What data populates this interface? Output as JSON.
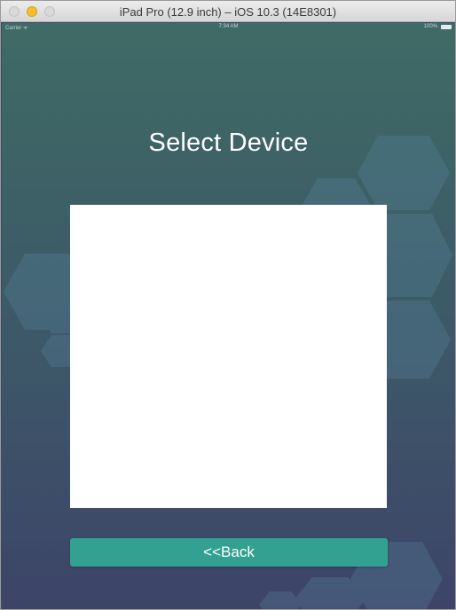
{
  "window": {
    "title": "iPad Pro (12.9 inch) – iOS 10.3 (14E8301)"
  },
  "statusbar": {
    "carrier": "Carrier ᯤ",
    "time": "7:34 AM",
    "battery": "100%"
  },
  "screen": {
    "title": "Select Device",
    "device_list_items": [],
    "back_label": "<<Back"
  },
  "colors": {
    "accent": "#33a191",
    "background_top": "#3f6b66",
    "background_bottom": "#3d4468"
  }
}
